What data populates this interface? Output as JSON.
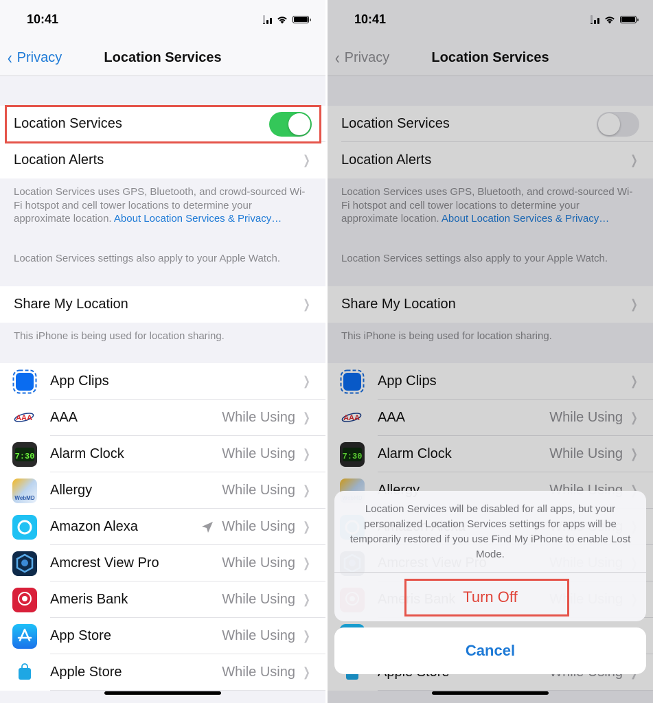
{
  "status_bar": {
    "time": "10:41"
  },
  "nav": {
    "back_label": "Privacy",
    "title": "Location Services"
  },
  "settings": {
    "location_services": {
      "label": "Location Services",
      "left_state": "on",
      "right_state": "off"
    },
    "location_alerts": {
      "label": "Location Alerts"
    },
    "description": {
      "text": "Location Services uses GPS, Bluetooth, and crowd-sourced Wi-Fi hotspot and cell tower locations to determine your approximate location. ",
      "link": "About Location Services & Privacy…",
      "watch_note": "Location Services settings also apply to your Apple Watch."
    },
    "share_my_location": {
      "label": "Share My Location",
      "footer": "This iPhone is being used for location sharing."
    }
  },
  "apps": [
    {
      "name": "App Clips",
      "value": "",
      "icon": "app-clips-icon"
    },
    {
      "name": "AAA",
      "value": "While Using",
      "icon": "aaa-icon"
    },
    {
      "name": "Alarm Clock",
      "value": "While Using",
      "icon": "alarm-clock-icon"
    },
    {
      "name": "Allergy",
      "value": "While Using",
      "icon": "webmd-allergy-icon"
    },
    {
      "name": "Amazon Alexa",
      "value": "While Using",
      "icon": "amazon-alexa-icon",
      "recent_use_arrow": true
    },
    {
      "name": "Amcrest View Pro",
      "value": "While Using",
      "icon": "amcrest-icon"
    },
    {
      "name": "Ameris Bank",
      "value": "While Using",
      "icon": "ameris-bank-icon"
    },
    {
      "name": "App Store",
      "value": "While Using",
      "icon": "app-store-icon"
    },
    {
      "name": "Apple Store",
      "value": "While Using",
      "icon": "apple-store-icon"
    }
  ],
  "alert": {
    "message": "Location Services will be disabled for all apps, but your personalized Location Services settings for apps will be temporarily restored if you use Find My iPhone to enable Lost Mode.",
    "turn_off_label": "Turn Off",
    "cancel_label": "Cancel"
  },
  "colors": {
    "accent": "#1e7ad6",
    "toggle_on": "#34c759",
    "destructive": "#e0453a",
    "highlight_box": "#e5544a"
  }
}
